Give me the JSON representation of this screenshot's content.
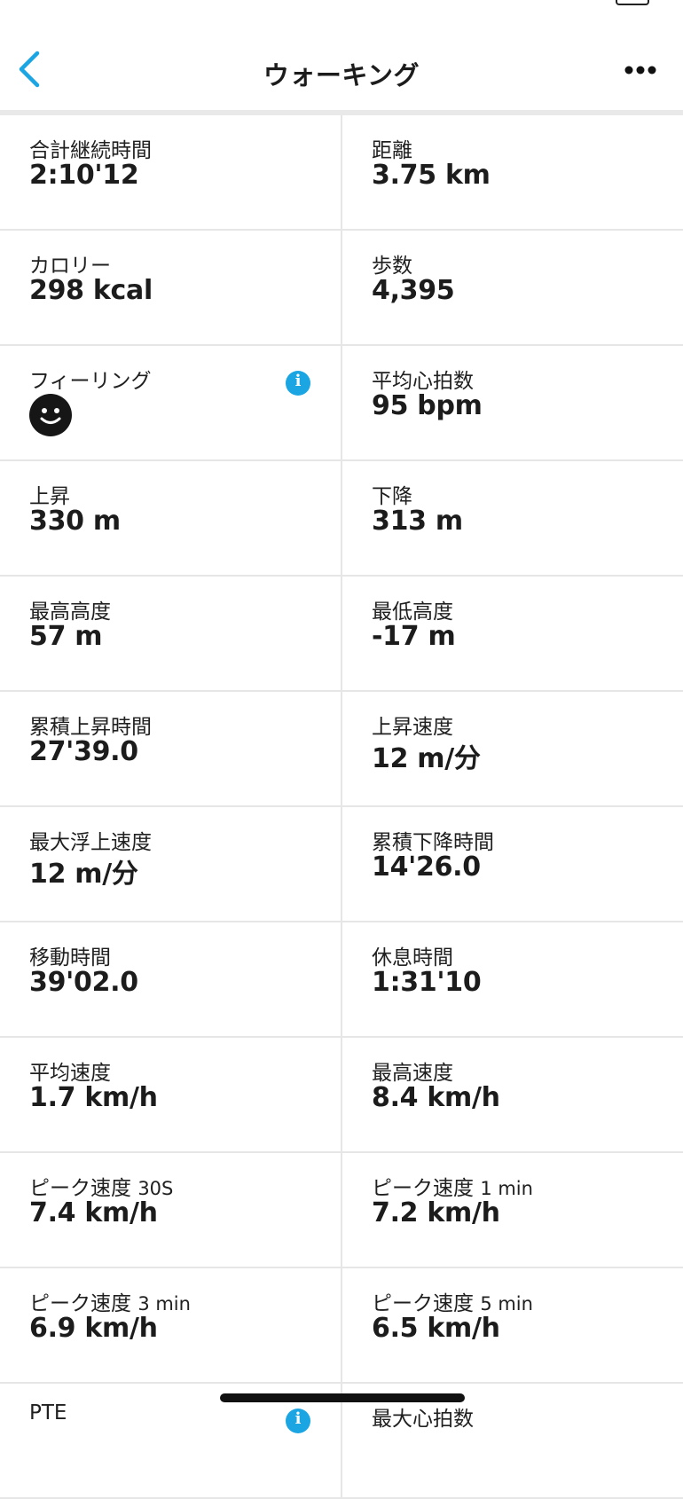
{
  "header": {
    "title": "ウォーキング"
  },
  "stats": [
    [
      {
        "label": "合計継続時間",
        "value": "2:10'12"
      },
      {
        "label": "距離",
        "value": "3.75 km"
      }
    ],
    [
      {
        "label": "カロリー",
        "value": "298 kcal"
      },
      {
        "label": "歩数",
        "value": "4,395"
      }
    ],
    [
      {
        "label": "フィーリング",
        "icon": "smiley-face-icon",
        "info": true
      },
      {
        "label": "平均心拍数",
        "value": "95 bpm"
      }
    ],
    [
      {
        "label": "上昇",
        "value": "330 m"
      },
      {
        "label": "下降",
        "value": "313 m"
      }
    ],
    [
      {
        "label": "最高高度",
        "value": "57 m"
      },
      {
        "label": "最低高度",
        "value": "-17 m"
      }
    ],
    [
      {
        "label": "累積上昇時間",
        "value": "27'39.0"
      },
      {
        "label": "上昇速度",
        "value": "12 m/分"
      }
    ],
    [
      {
        "label": "最大浮上速度",
        "value": "12 m/分"
      },
      {
        "label": "累積下降時間",
        "value": "14'26.0"
      }
    ],
    [
      {
        "label": "移動時間",
        "value": "39'02.0"
      },
      {
        "label": "休息時間",
        "value": "1:31'10"
      }
    ],
    [
      {
        "label": "平均速度",
        "value": "1.7 km/h"
      },
      {
        "label": "最高速度",
        "value": "8.4 km/h"
      }
    ],
    [
      {
        "label": "ピーク速度",
        "label_unit": "30S",
        "value": "7.4 km/h"
      },
      {
        "label": "ピーク速度",
        "label_unit": "1 min",
        "value": "7.2 km/h"
      }
    ],
    [
      {
        "label": "ピーク速度",
        "label_unit": "3 min",
        "value": "6.9 km/h"
      },
      {
        "label": "ピーク速度",
        "label_unit": "5 min",
        "value": "6.5 km/h"
      }
    ],
    [
      {
        "label": "PTE",
        "info": true
      },
      {
        "label": "最大心拍数"
      }
    ]
  ],
  "colors": {
    "accent": "#1ba6e3",
    "divider": "#e6e6e6",
    "text": "#1c1c1c"
  },
  "icons": {
    "back": "chevron-left-icon",
    "more": "more-horizontal-icon",
    "info": "info-icon",
    "feeling": "smiley-face-icon"
  }
}
